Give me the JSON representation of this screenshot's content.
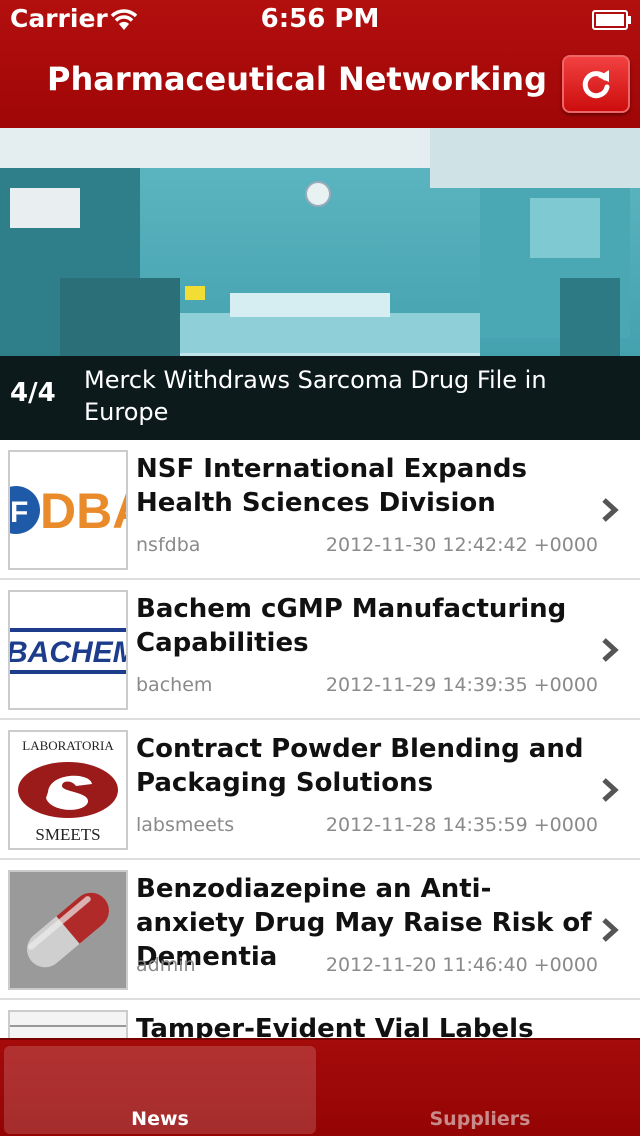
{
  "status_bar": {
    "carrier": "Carrier",
    "time": "6:56 PM"
  },
  "nav": {
    "title": "Pharmaceutical Networking",
    "refresh_icon": "refresh-icon"
  },
  "hero": {
    "counter": "4/4",
    "title": "Merck Withdraws Sarcoma Drug File in Europe"
  },
  "articles": [
    {
      "title": "NSF International Expands Health Sciences Division",
      "author": "nsfdba",
      "date": "2012-11-30 12:42:42 +0000",
      "thumb_text": "DBA"
    },
    {
      "title": "Bachem cGMP Manufacturing Capabilities",
      "author": "bachem",
      "date": "2012-11-29 14:39:35 +0000",
      "thumb_text": "BACHEM"
    },
    {
      "title": "Contract Powder Blending and Packaging Solutions",
      "author": "labsmeets",
      "date": "2012-11-28 14:35:59 +0000",
      "thumb_top": "LABORATORIA",
      "thumb_bottom": "SMEETS"
    },
    {
      "title": "Benzodiazepine an Anti-anxiety Drug May Raise Risk of Dementia",
      "author": "admin",
      "date": "2012-11-20 11:46:40 +0000"
    },
    {
      "title": "Tamper-Evident Vial Labels",
      "author": "",
      "date": ""
    }
  ],
  "tabs": [
    {
      "label": "News",
      "active": true
    },
    {
      "label": "Suppliers",
      "active": false
    }
  ],
  "colors": {
    "brand_red": "#a00606",
    "refresh_red": "#e22020",
    "meta_gray": "#8a8a8a"
  }
}
